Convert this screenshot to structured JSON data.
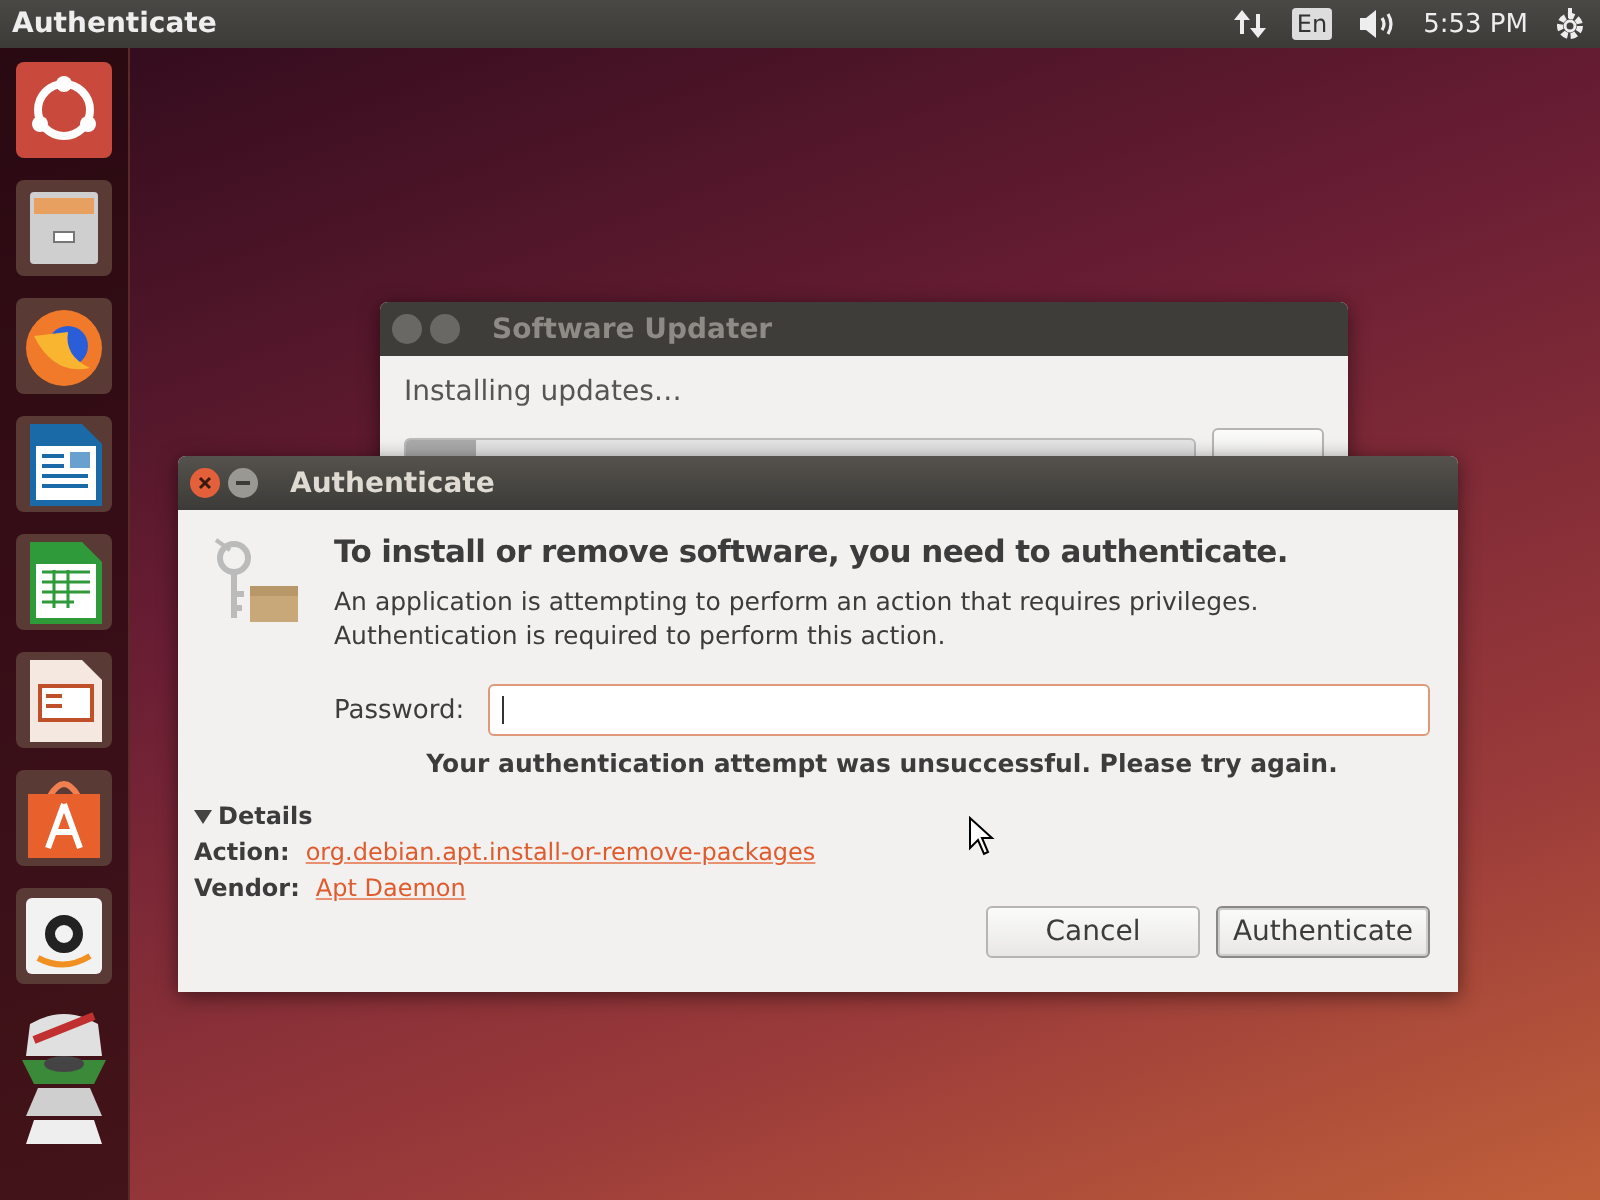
{
  "top_bar": {
    "title": "Authenticate",
    "keyboard": "En",
    "clock": "5:53 PM"
  },
  "updater": {
    "title": "Software Updater",
    "status": "Installing updates…",
    "level": 0.09
  },
  "dialog": {
    "title": "Authenticate",
    "heading": "To install or remove software, you need to authenticate.",
    "message": "An application is attempting to perform an action that requires privileges. Authentication is required to perform this action.",
    "password_label": "Password:",
    "password": {
      "focused": true
    },
    "error": "Your authentication attempt was unsuccessful. Please try again.",
    "details": {
      "label": "Details",
      "expanded": true,
      "rows": [
        {
          "label": "Action:",
          "value": "org.debian.apt.install-or-remove-packages"
        },
        {
          "label": "Vendor:",
          "value": "Apt Daemon"
        }
      ]
    },
    "buttons": [
      {
        "label": "Cancel",
        "default": false
      },
      {
        "label": "Authenticate",
        "default": true
      }
    ]
  }
}
